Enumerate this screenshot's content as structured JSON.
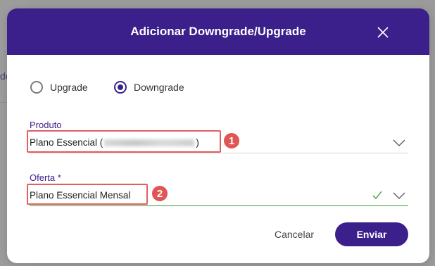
{
  "backdrop": {
    "partial_text": "de"
  },
  "modal": {
    "title": "Adicionar Downgrade/Upgrade",
    "close_icon": "close-icon"
  },
  "radio": {
    "options": [
      {
        "label": "Upgrade",
        "checked": false
      },
      {
        "label": "Downgrade",
        "checked": true
      }
    ]
  },
  "produto": {
    "label": "Produto",
    "value_prefix": "Plano Essencial (",
    "value_suffix": ")",
    "annotation": "1"
  },
  "oferta": {
    "label": "Oferta *",
    "value": "Plano Essencial Mensal",
    "annotation": "2"
  },
  "actions": {
    "cancel_label": "Cancelar",
    "send_label": "Enviar"
  },
  "colors": {
    "primary": "#3b1f8a",
    "valid": "#3c9a3c",
    "annotation": "#e05555"
  }
}
